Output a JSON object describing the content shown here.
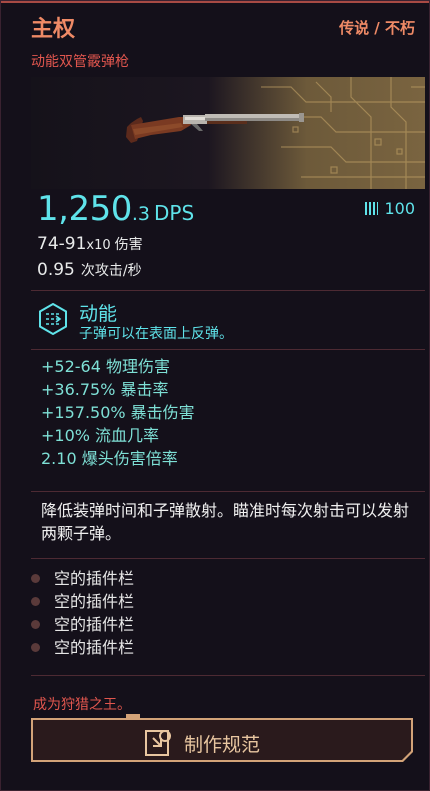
{
  "header": {
    "name": "主权",
    "rarity": "传说 / 不朽",
    "subtype": "动能双管霰弹枪"
  },
  "stats_main": {
    "dps_int": "1,250",
    "dps_dec": ".3",
    "dps_unit": "DPS",
    "ammo": "100",
    "damage": "74-91",
    "damage_mult": "x10",
    "damage_label": "伤害",
    "attack_rate": "0.95",
    "attack_rate_label": "次攻击/秒"
  },
  "tech": {
    "title": "动能",
    "description": "子弹可以在表面上反弹。"
  },
  "bonuses": [
    "+52-64 物理伤害",
    "+36.75% 暴击率",
    "+157.50% 暴击伤害",
    "+10% 流血几率",
    "2.10 爆头伤害倍率"
  ],
  "description": "降低装弹时间和子弹散射。瞄准时每次射击可以发射两颗子弹。",
  "slots": [
    "空的插件栏",
    "空的插件栏",
    "空的插件栏",
    "空的插件栏"
  ],
  "quote": "成为狩猎之王。",
  "craft": {
    "label": "制作规范"
  },
  "colors": {
    "accent_cyan": "#5fe3ea",
    "accent_orange": "#ef8a66",
    "accent_red": "#e0564e",
    "button_gold": "#d3a378"
  },
  "icons": {
    "tech": "kinetic-tech-icon",
    "ammo": "ammo-icon",
    "craft": "crafting-spec-icon"
  }
}
